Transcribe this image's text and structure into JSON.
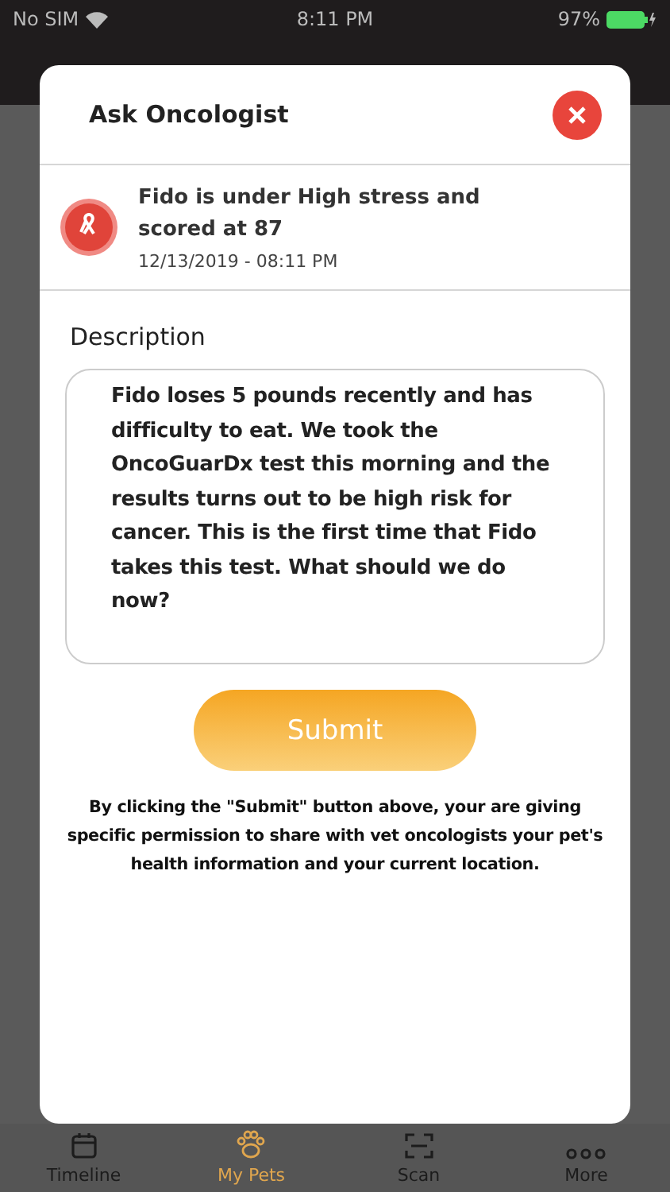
{
  "status_bar": {
    "carrier": "No SIM",
    "time": "8:11 PM",
    "battery": "97%"
  },
  "dialog": {
    "title": "Ask Oncologist",
    "result": {
      "headline": "Fido is under High stress and scored at 87",
      "timestamp": "12/13/2019 - 08:11 PM"
    },
    "description": {
      "label": "Description",
      "value": "Fido loses 5 pounds recently and has difficulty to eat. We took the OncoGuarDx test this morning and the results turns out to be high risk for cancer. This is the first time that Fido takes this test. What should we do now?"
    },
    "submit": "Submit",
    "notice": "By clicking the \"Submit\" button above, your are giving specific permission to share with vet oncologists your pet's health information and your current location."
  },
  "tabs": [
    {
      "label": "Timeline",
      "kind": "calendar",
      "selected": false
    },
    {
      "label": "My Pets",
      "kind": "paw",
      "selected": true
    },
    {
      "label": "Scan",
      "kind": "scan",
      "selected": false
    },
    {
      "label": "More",
      "kind": "dots",
      "selected": false
    }
  ]
}
